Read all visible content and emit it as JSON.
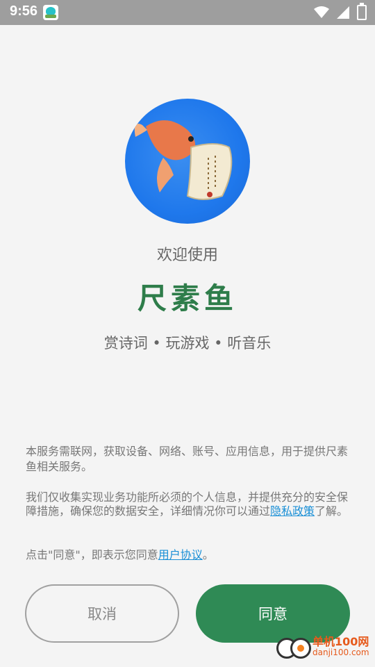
{
  "status_bar": {
    "time": "9:56"
  },
  "welcome": "欢迎使用",
  "app_name": "尺素鱼",
  "tagline": "赏诗词 • 玩游戏 • 听音乐",
  "terms": {
    "p1": "本服务需联网，获取设备、网络、账号、应用信息，用于提供尺素鱼相关服务。",
    "p2_before": "我们仅收集实现业务功能所必须的个人信息，并提供充分的安全保障措施，确保您的数据安全，详细情况你可以通过",
    "privacy_link": "隐私政策",
    "p2_after": "了解。",
    "p3_before": "点击\"同意\"，即表示您同意",
    "user_agreement_link": "用户协议",
    "p3_after": "。"
  },
  "buttons": {
    "cancel": "取消",
    "agree": "同意"
  },
  "watermark": {
    "cn": "单机100网",
    "url": "danji100.com"
  },
  "colors": {
    "accent": "#2f8a55",
    "link": "#1a8fd6",
    "logo_bg": "#1f78ec"
  }
}
